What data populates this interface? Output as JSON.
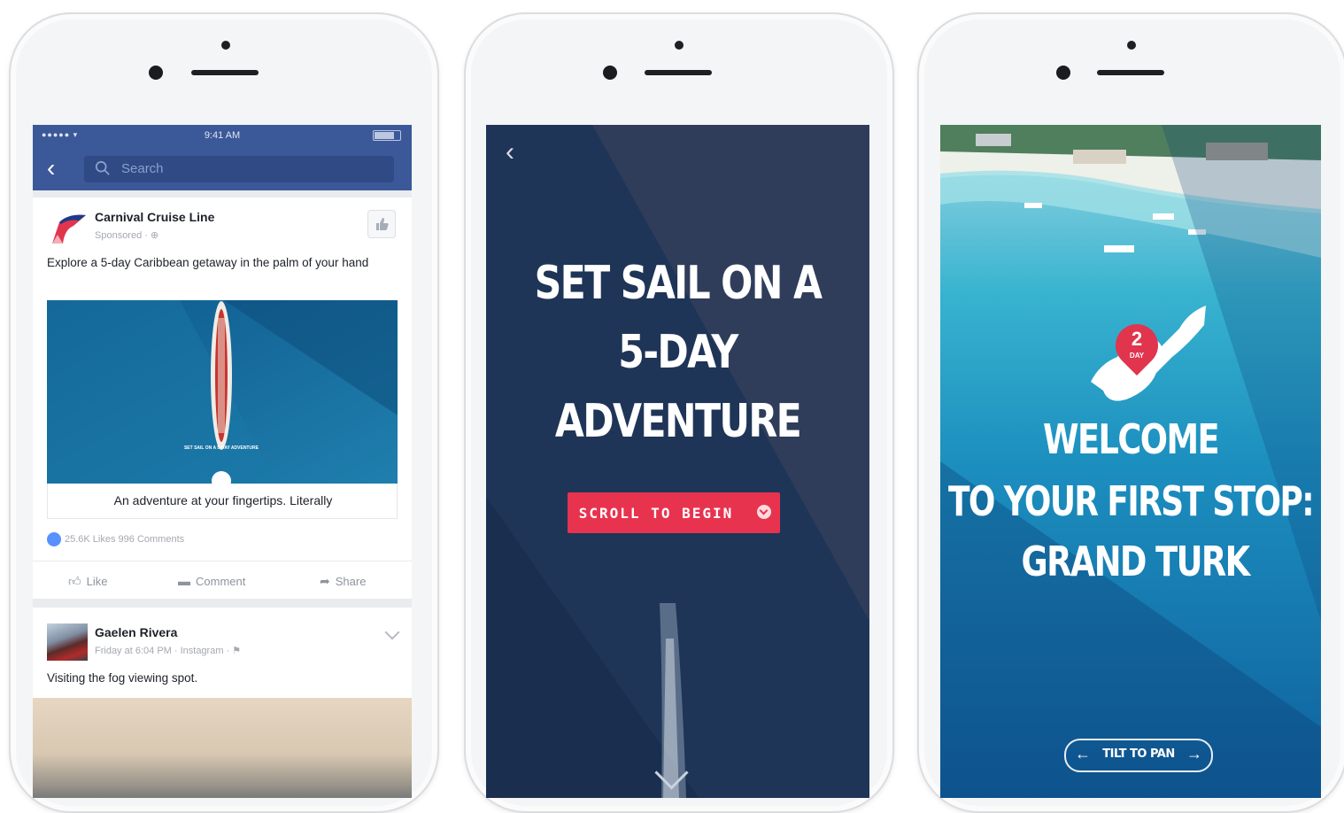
{
  "phone1": {
    "status": {
      "signal": "●●●●● ▾",
      "time": "9:41 AM"
    },
    "search": {
      "placeholder": "Search"
    },
    "post1": {
      "page_name": "Carnival Cruise Line",
      "sponsored": "Sponsored · ⊕",
      "text": "Explore a 5-day Caribbean getaway in the palm of your hand",
      "caption": "An adventure at your fingertips. Literally",
      "reactions": "25.6K Likes   996 Comments",
      "actions": {
        "like": "Like",
        "comment": "Comment",
        "share": "Share"
      }
    },
    "post2": {
      "name": "Gaelen Rivera",
      "meta": "Friday at 6:04 PM · Instagram · ⚑",
      "text": "Visiting the fog viewing spot."
    }
  },
  "phone2": {
    "title_lines": [
      "SET SAIL ON A",
      "5-DAY",
      "ADVENTURE"
    ],
    "button": "SCROLL TO BEGIN",
    "accent": "#e8334f"
  },
  "phone3": {
    "pin_number": "2",
    "pin_label": "DAY",
    "welcome": "WELCOME",
    "line2": "TO YOUR FIRST STOP:",
    "line3": "GRAND TURK",
    "tilt": "TILT TO PAN"
  },
  "colors": {
    "facebook_blue": "#3b5998",
    "carnival_red": "#e0354d"
  }
}
